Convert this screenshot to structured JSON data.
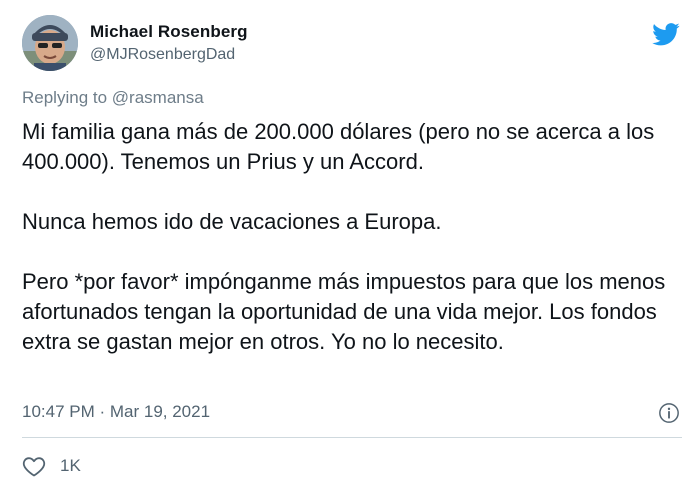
{
  "author": {
    "display_name": "Michael Rosenberg",
    "handle": "@MJRosenbergDad"
  },
  "reply": {
    "prefix": "Replying to ",
    "mention": "@rasmansa"
  },
  "tweet": {
    "paragraphs": [
      "Mi familia gana más de 200.000 dólares (pero no se acerca a los 400.000). Tenemos un Prius y un Accord.",
      "Nunca hemos ido de vacaciones a Europa.",
      "Pero *por favor* impónganme más impuestos para que los menos afortunados tengan la oportunidad de una vida mejor. Los fondos extra se gastan mejor en otros. Yo no lo necesito."
    ],
    "timestamp": "10:47 PM · Mar 19, 2021"
  },
  "actions": {
    "like_count": "1K"
  },
  "icons": {
    "brand": "twitter-bird-icon",
    "info": "info-icon",
    "like": "heart-icon"
  },
  "colors": {
    "twitter_blue": "#1d9bf0",
    "secondary_text": "#536471",
    "divider": "#cfd9de"
  }
}
